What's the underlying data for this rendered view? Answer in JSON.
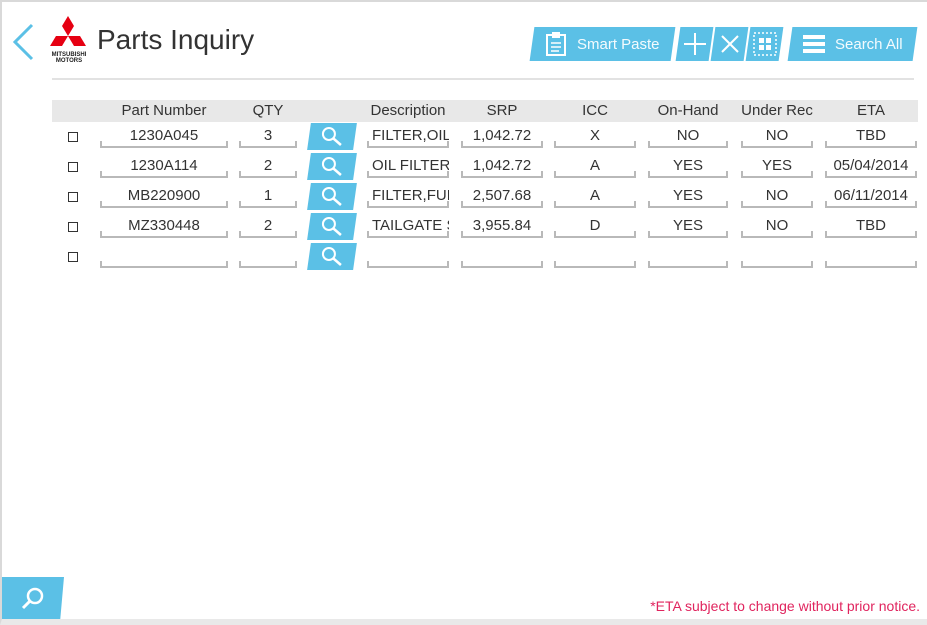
{
  "header": {
    "title": "Parts Inquiry",
    "logo_text_line1": "MITSUBISHI",
    "logo_text_line2": "MOTORS"
  },
  "toolbar": {
    "smart_paste_label": "Smart Paste",
    "search_all_label": "Search All",
    "add_icon": "plus-icon",
    "clear_icon": "close-icon",
    "grid_icon": "grid-icon"
  },
  "columns": [
    "Part Number",
    "QTY",
    "Description",
    "SRP",
    "ICC",
    "On-Hand",
    "Under Rec",
    "ETA"
  ],
  "rows": [
    {
      "part": "1230A045",
      "qty": "3",
      "desc": "FILTER,OIL",
      "srp": "1,042.72",
      "icc": "X",
      "onhand": "NO",
      "underrec": "NO",
      "eta": "TBD"
    },
    {
      "part": "1230A114",
      "qty": "2",
      "desc": "OIL FILTER",
      "srp": "1,042.72",
      "icc": "A",
      "onhand": "YES",
      "underrec": "YES",
      "eta": "05/04/2014"
    },
    {
      "part": "MB220900",
      "qty": "1",
      "desc": "FILTER,FUEL",
      "srp": "2,507.68",
      "icc": "A",
      "onhand": "YES",
      "underrec": "NO",
      "eta": "06/11/2014"
    },
    {
      "part": "MZ330448",
      "qty": "2",
      "desc": "TAILGATE S",
      "srp": "3,955.84",
      "icc": "D",
      "onhand": "YES",
      "underrec": "NO",
      "eta": "TBD"
    },
    {
      "part": "",
      "qty": "",
      "desc": "",
      "srp": "",
      "icc": "",
      "onhand": "",
      "underrec": "",
      "eta": ""
    }
  ],
  "footnote": "*ETA subject to change without prior notice.",
  "colors": {
    "accent": "#5bc0e6",
    "brand_red": "#e60012",
    "footnote": "#e0245e"
  }
}
